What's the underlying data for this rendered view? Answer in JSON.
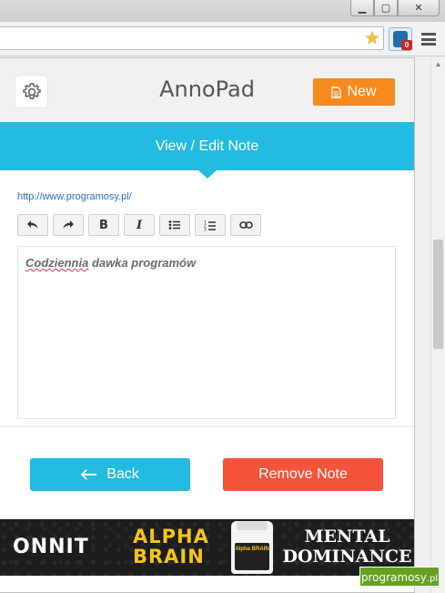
{
  "browser": {
    "window_controls": {
      "minimize": "▁",
      "maximize": "▢",
      "close": "✕"
    },
    "extension_badge": "0",
    "icons": {
      "star": "star-icon",
      "menu": "menu-icon",
      "extension": "annopad-extension-icon"
    }
  },
  "popup": {
    "app_title": "AnnoPad",
    "new_button": "New",
    "section_title": "View / Edit Note",
    "note_url": "http://www.programosy.pl/",
    "editor_toolbar": [
      "undo",
      "redo",
      "bold",
      "italic",
      "bullet-list",
      "numbered-list",
      "link"
    ],
    "note_text_misspelled": "Codziennia",
    "note_text_rest": " dawka programów",
    "back_button": "Back",
    "remove_button": "Remove Note",
    "colors": {
      "accent": "#23bbdf",
      "new": "#f68a1f",
      "remove": "#f6533c"
    }
  },
  "ad": {
    "brand": "ONNIT",
    "product_line1": "ALPHA",
    "product_line2": "BRAIN",
    "bottle_label": "Alpha BRAIN",
    "tagline_line1": "MENTAL",
    "tagline_line2": "DOMINANCE"
  },
  "watermark": {
    "name": "programosy",
    "suffix": ".pl"
  }
}
